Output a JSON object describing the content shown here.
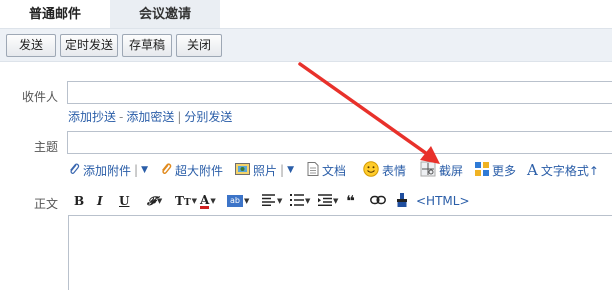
{
  "tabs": {
    "active": "普通邮件",
    "inactive": "会议邀请"
  },
  "toolbar": {
    "send": "发送",
    "scheduled_send": "定时发送",
    "save_draft": "存草稿",
    "close": "关闭"
  },
  "form": {
    "to_label": "收件人",
    "cc_link": "添加抄送",
    "dash": "-",
    "bcc_link": "添加密送",
    "bar": "|",
    "separate_link": "分别发送",
    "subject_label": "主题",
    "body_label": "正文"
  },
  "attach_bar": {
    "attachment": "添加附件",
    "large_attachment": "超大附件",
    "photo": "照片",
    "document": "文档",
    "emoji": "表情",
    "screenshot": "截屏",
    "more": "更多",
    "text_format": "文字格式↑"
  },
  "editor_bar": {
    "bold": "B",
    "italic": "I",
    "underline": "U",
    "quote": "❝",
    "html": "<HTML>"
  },
  "colors": {
    "accent": "#2b5ea8",
    "annotation_arrow": "#e8312b"
  }
}
